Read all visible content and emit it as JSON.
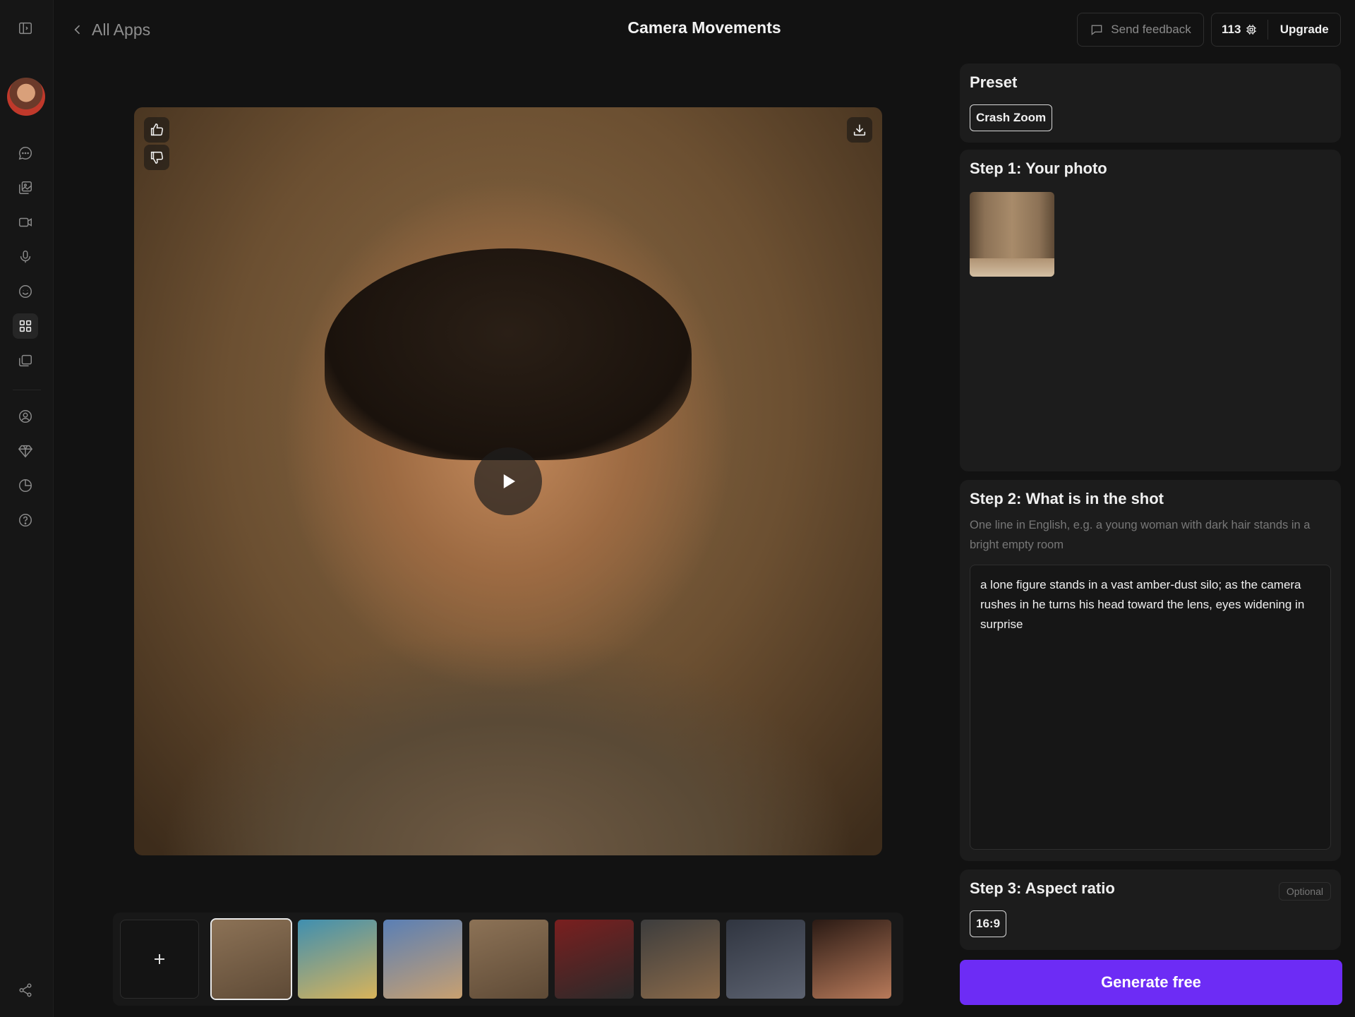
{
  "header": {
    "back_label": "All Apps",
    "title": "Camera Movements",
    "feedback_label": "Send feedback",
    "credits": "113",
    "upgrade_label": "Upgrade"
  },
  "sidebar": {
    "items": [
      {
        "icon": "sidebar-toggle-icon"
      },
      {
        "icon": "chat-icon"
      },
      {
        "icon": "image-gallery-icon"
      },
      {
        "icon": "video-camera-icon"
      },
      {
        "icon": "microphone-icon"
      },
      {
        "icon": "smile-icon"
      },
      {
        "icon": "apps-grid-icon",
        "active": true
      },
      {
        "icon": "folders-icon"
      },
      {
        "icon": "user-circle-icon"
      },
      {
        "icon": "diamond-icon"
      },
      {
        "icon": "pie-chart-icon"
      },
      {
        "icon": "help-icon"
      },
      {
        "icon": "share-icon"
      }
    ]
  },
  "preview": {
    "colors": {
      "amber": "#8a6a45",
      "skin": "#c48a5c",
      "shirt": "#6e5a44"
    }
  },
  "thumbnails": {
    "count_selected_index": 0,
    "items": [
      {
        "name": "silo-figure",
        "colors": [
          "#8c7256",
          "#5e4a36"
        ]
      },
      {
        "name": "woman-blue-wall",
        "colors": [
          "#3f8fb0",
          "#d8b35a"
        ]
      },
      {
        "name": "motel-walkway",
        "colors": [
          "#5a7fb5",
          "#c8a070"
        ]
      },
      {
        "name": "silo-figure-2",
        "colors": [
          "#8c7256",
          "#5e4a36"
        ]
      },
      {
        "name": "subway-corridor",
        "colors": [
          "#7a1f1f",
          "#2a2a2a"
        ]
      },
      {
        "name": "cowboy-portrait",
        "colors": [
          "#3d3d3d",
          "#8a6a4a"
        ]
      },
      {
        "name": "stairs-figure",
        "colors": [
          "#303540",
          "#5c6270"
        ]
      },
      {
        "name": "woman-sunglasses",
        "colors": [
          "#2a1a14",
          "#b87a5a"
        ]
      }
    ]
  },
  "panel": {
    "preset": {
      "title": "Preset",
      "chip": "Crash Zoom"
    },
    "step1": {
      "title": "Step 1: Your photo"
    },
    "step2": {
      "title": "Step 2: What is in the shot",
      "helper": "One line in English, e.g. a young woman with dark hair stands in a bright empty room",
      "value": "a lone figure stands in a vast amber-dust silo; as the camera rushes in he turns his head toward the lens, eyes widening in surprise"
    },
    "step3": {
      "title": "Step 3: Aspect ratio",
      "optional": "Optional",
      "ratio": "16:9"
    },
    "generate_label": "Generate free",
    "accent": "#6d2cf5"
  }
}
